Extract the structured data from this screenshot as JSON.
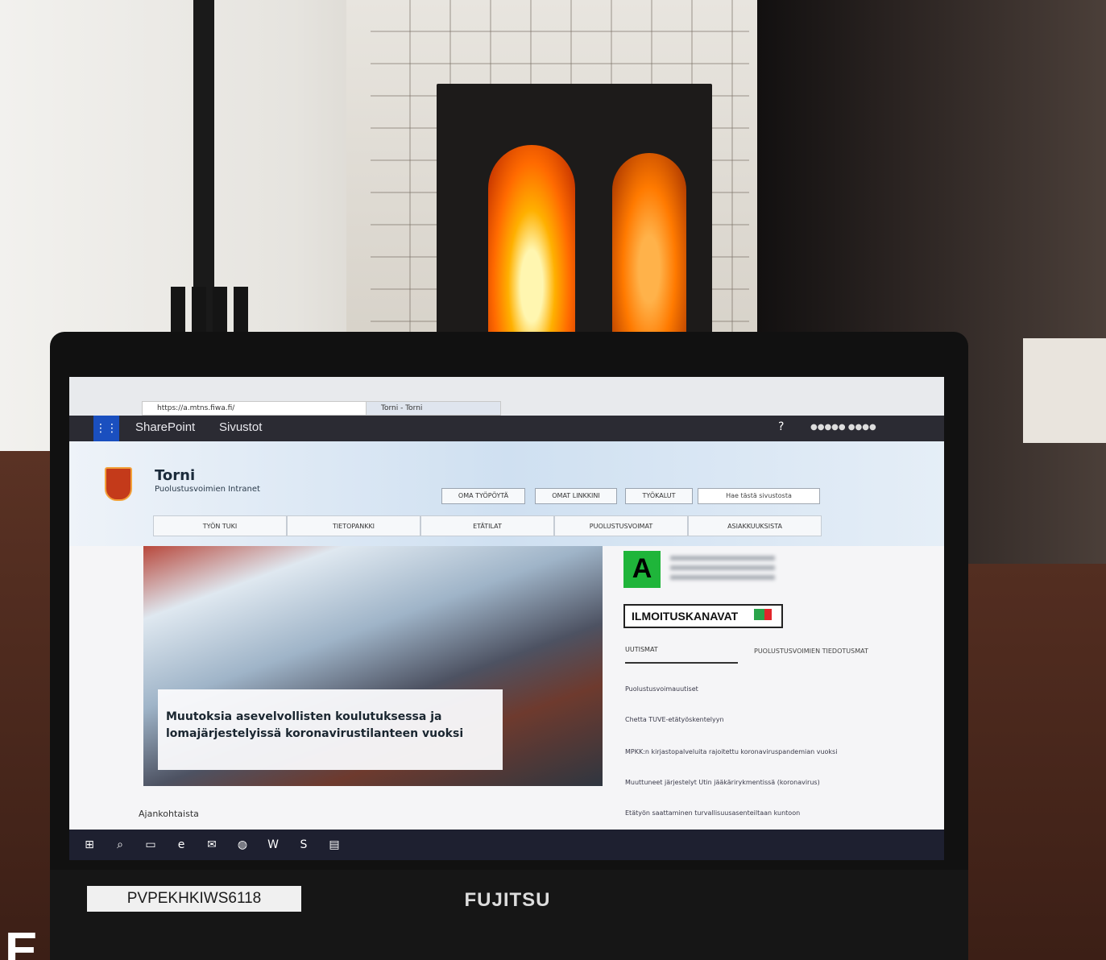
{
  "photo": {
    "asset_tag": "PVPEKHKIWS6118",
    "laptop_brand": "FUJITSU",
    "caption_partial": "E"
  },
  "browser": {
    "url": "https://a.mtns.fiwa.fi/",
    "tab_title": "Torni - Torni"
  },
  "sharepoint_bar": {
    "app_name": "SharePoint",
    "link": "Sivustot",
    "help": "?"
  },
  "site": {
    "title": "Torni",
    "subtitle": "Puolustusvoimien Intranet",
    "header_buttons": [
      "OMA TYÖPÖYTÄ",
      "OMAT LINKKINI",
      "TYÖKALUT"
    ],
    "search_placeholder": "Hae tästä sivustosta",
    "nav": [
      "TYÖN TUKI",
      "TIETOPANKKI",
      "ETÄTILAT",
      "PUOLUSTUSVOIMAT",
      "ASIAKKUUKSISTA"
    ]
  },
  "hero": {
    "title": "Muutoksia asevelvollisten koulutuksessa ja lomajärjestelyissä koronavirustilanteen vuoksi"
  },
  "sidebar": {
    "badge_letter": "A",
    "notice_channels": "ILMOITUSKANAVAT",
    "news_tabs": [
      "UUTISMAT",
      "PUOLUSTUSVOIMIEN TIEDOTUSMAT"
    ],
    "news": [
      "Puolustusvoimauutiset",
      "Chetta TUVE-etätyöskentelyyn",
      "MPKK:n kirjastopalveluita rajoitettu koronaviruspandemian vuoksi",
      "Muuttuneet järjestelyt Utin jääkärirykmentissä (koronavirus)",
      "Etätyön saattaminen turvallisuusasenteiltaan kuntoon"
    ]
  },
  "footer": {
    "section_title": "Ajankohtaista"
  },
  "colors": {
    "sharepoint_bar": "#2b2b33",
    "waffle": "#1a4fbf",
    "badge_green": "#1fb53a",
    "taskbar": "#1e2030"
  }
}
